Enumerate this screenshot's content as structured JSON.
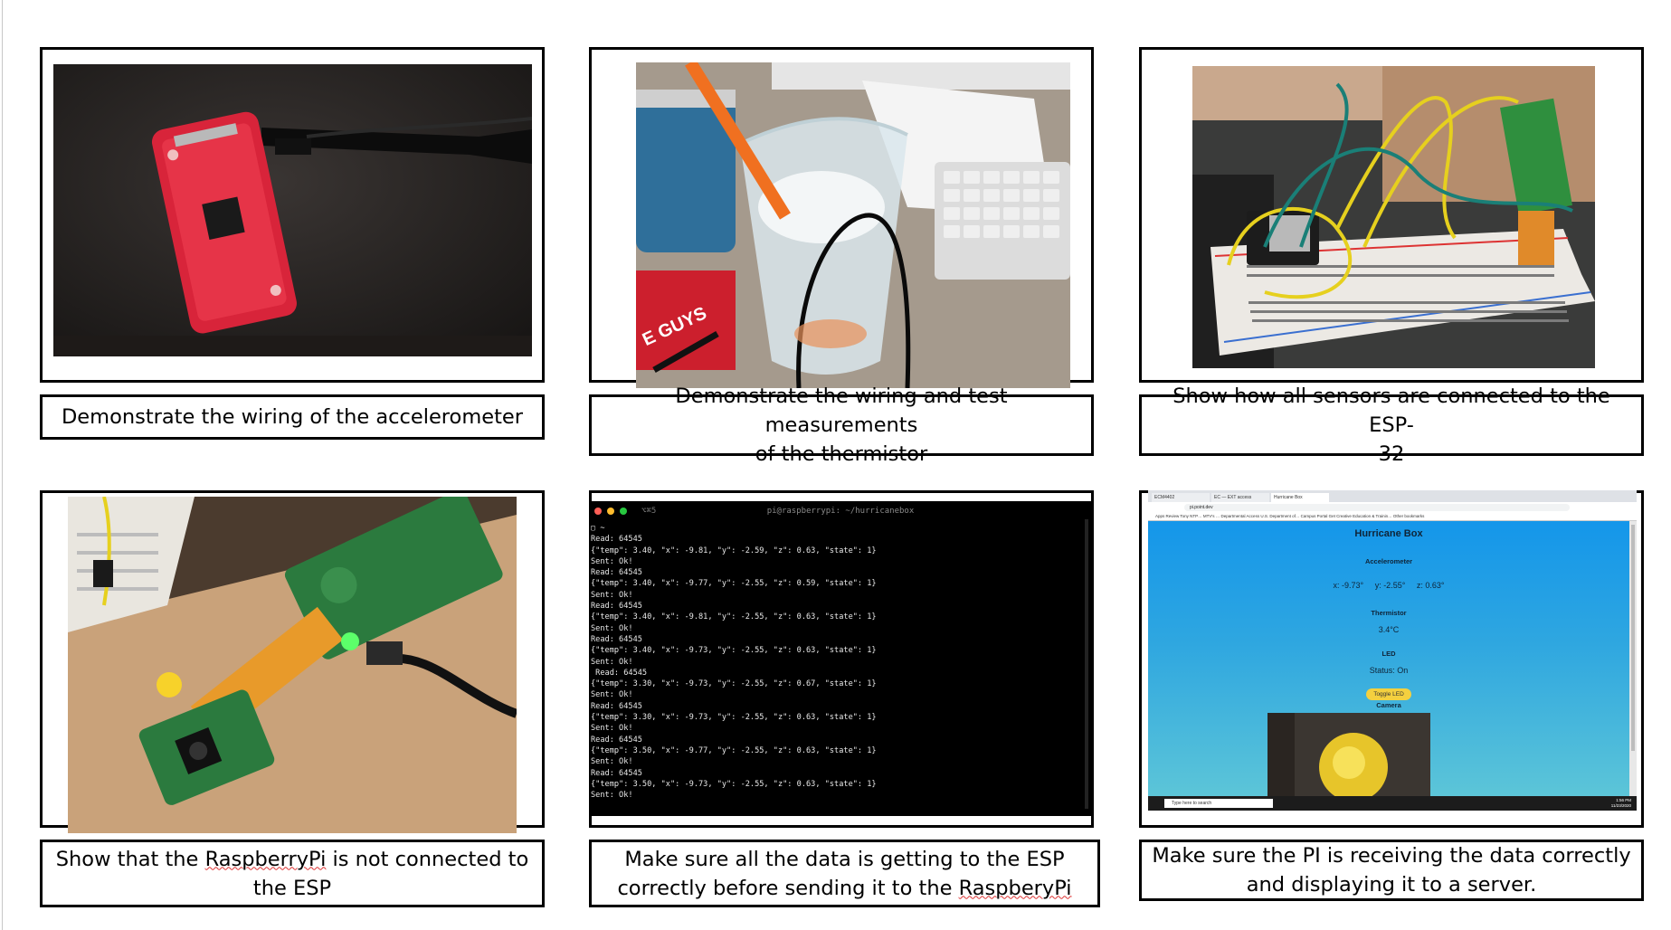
{
  "captions": {
    "c1": "Demonstrate the wiring of the accelerometer",
    "c2_line1": "Demonstrate the wiring and test measurements",
    "c2_line2": "of the thermistor",
    "c3_line1": "Show how all sensors are connected to the ESP-",
    "c3_line2": "32",
    "c4_pre": "Show that the ",
    "c4_word": "RaspberryPi",
    "c4_post": " is not connected to",
    "c4_line2": "the ESP",
    "c5_line1": "Make sure all the data is getting to the ESP",
    "c5_pre": "correctly before sending it to the ",
    "c5_word": "RaspberyPi",
    "c6_line1": "Make sure the PI is receiving the data correctly",
    "c6_line2": "and displaying it to a server."
  },
  "photo_labels": {
    "cup_text": "E GUYS"
  },
  "terminal": {
    "title": "pi@raspberrypi: ~/hurricanebox",
    "shortcut": "⌥⌘5",
    "prompt": "▢ ~",
    "lines": [
      "Read: 64545",
      "{\"temp\": 3.40, \"x\": -9.81, \"y\": -2.59, \"z\": 0.63, \"state\": 1}",
      "Sent: Ok!",
      "Read: 64545",
      "{\"temp\": 3.40, \"x\": -9.77, \"y\": -2.55, \"z\": 0.59, \"state\": 1}",
      "Sent: Ok!",
      "Read: 64545",
      "{\"temp\": 3.40, \"x\": -9.81, \"y\": -2.55, \"z\": 0.63, \"state\": 1}",
      "Sent: Ok!",
      "Read: 64545",
      "{\"temp\": 3.40, \"x\": -9.73, \"y\": -2.55, \"z\": 0.63, \"state\": 1}",
      "Sent: Ok!",
      " Read: 64545",
      "{\"temp\": 3.30, \"x\": -9.73, \"y\": -2.55, \"z\": 0.67, \"state\": 1}",
      "Sent: Ok!",
      "Read: 64545",
      "{\"temp\": 3.30, \"x\": -9.73, \"y\": -2.55, \"z\": 0.63, \"state\": 1}",
      "Sent: Ok!",
      "Read: 64545",
      "{\"temp\": 3.50, \"x\": -9.77, \"y\": -2.55, \"z\": 0.63, \"state\": 1}",
      "Sent: Ok!",
      "Read: 64545",
      "{\"temp\": 3.50, \"x\": -9.73, \"y\": -2.55, \"z\": 0.63, \"state\": 1}",
      "Sent: Ok!"
    ]
  },
  "browser": {
    "tabs": [
      "ECM4402",
      "EC — EXT access",
      "Hurricane Box"
    ],
    "url": "pi.point.dev",
    "bookmarks": "Apps   Review Tony NTP…   MTV's …   Departmental Access   U.S. Department of…   Campus Portal   Get Creative   Education & Trainin…   Other bookmarks",
    "page_title": "Hurricane Box",
    "accel_heading": "Accelerometer",
    "accel_x": "x: -9.73°",
    "accel_y": "y: -2.55°",
    "accel_z": "z: 0.63°",
    "therm_heading": "Thermistor",
    "therm_value": "3.4°C",
    "led_heading": "LED",
    "led_status": "Status: On",
    "led_button": "Toggle LED",
    "camera_heading": "Camera",
    "taskbar_search": "Type here to search",
    "clock_time": "1:56 PM",
    "clock_date": "11/23/2020"
  }
}
